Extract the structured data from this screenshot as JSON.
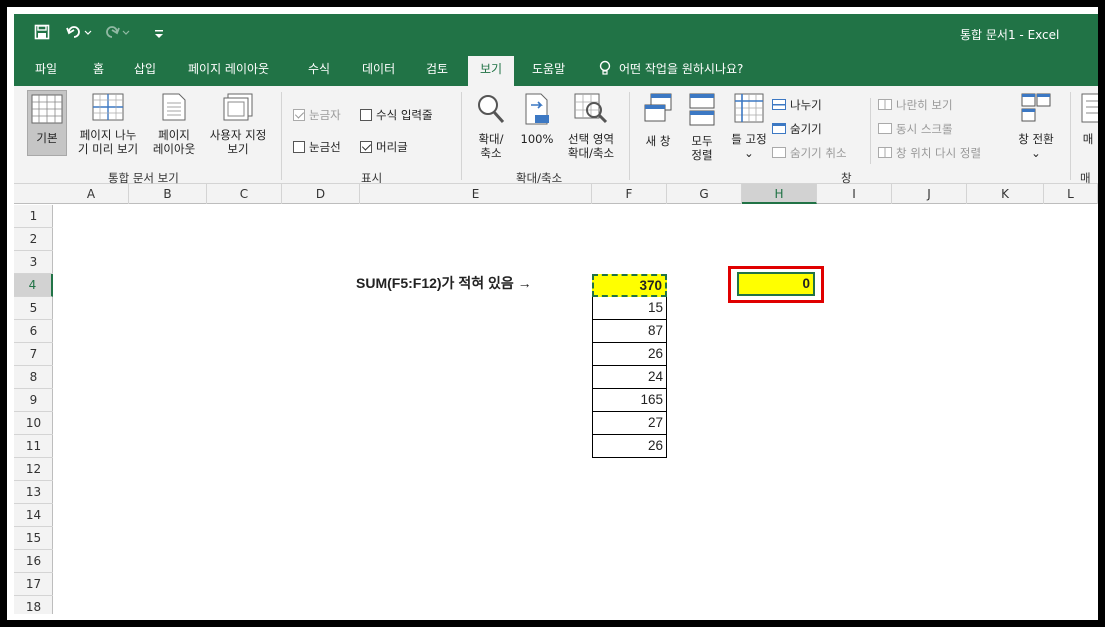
{
  "titlebar": {
    "save_icon": "save-icon",
    "undo_icon": "undo-icon",
    "redo_icon": "redo-icon",
    "customize_icon": "customize-qat-icon",
    "doc_title": "통합 문서1 - Excel"
  },
  "tabs": {
    "items": [
      "파일",
      "홈",
      "삽입",
      "페이지 레이아웃",
      "수식",
      "데이터",
      "검토",
      "보기",
      "도움말"
    ],
    "active": "보기",
    "tell_me": "어떤 작업을 원하시나요?"
  },
  "ribbon": {
    "workbook_views": {
      "normal": "기본",
      "page_break_line1": "페이지 나누",
      "page_break_line2": "기 미리 보기",
      "page_layout_line1": "페이지",
      "page_layout_line2": "레이아웃",
      "custom_line1": "사용자 지정",
      "custom_line2": "보기",
      "group_label": "통합 문서 보기"
    },
    "show": {
      "ruler": "눈금자",
      "formula_bar": "수식 입력줄",
      "gridlines": "눈금선",
      "headings": "머리글",
      "group_label": "표시"
    },
    "zoom": {
      "zoom_line1": "확대/",
      "zoom_line2": "축소",
      "hundred": "100%",
      "selection_line1": "선택 영역",
      "selection_line2": "확대/축소",
      "group_label": "확대/축소"
    },
    "window": {
      "new_window": "새 창",
      "arrange_line1": "모두",
      "arrange_line2": "정렬",
      "freeze": "틀 고정",
      "split": "나누기",
      "hide": "숨기기",
      "unhide": "숨기기 취소",
      "side_by_side": "나란히 보기",
      "sync_scroll": "동시 스크롤",
      "reset_pos": "창 위치 다시 정렬",
      "switch": "창 전환",
      "group_label": "창"
    },
    "macro_partial": "매",
    "macro_group_partial": "매"
  },
  "grid": {
    "columns": [
      "A",
      "B",
      "C",
      "D",
      "E",
      "F",
      "G",
      "H",
      "I",
      "J",
      "K",
      "L"
    ],
    "selected_column": "H",
    "rows": [
      "1",
      "2",
      "3",
      "4",
      "5",
      "6",
      "7",
      "8",
      "9",
      "10",
      "11",
      "12",
      "13",
      "14",
      "15",
      "16",
      "17",
      "18"
    ],
    "selected_row": "4",
    "note": "SUM(F5:F12)가 적혀 있음 →",
    "f_values": [
      "370",
      "15",
      "87",
      "26",
      "24",
      "165",
      "27",
      "26"
    ],
    "h4_value": "0",
    "colors": {
      "highlight": "#ffff00",
      "excel_green": "#217346",
      "annotation_red": "#e00000"
    }
  }
}
